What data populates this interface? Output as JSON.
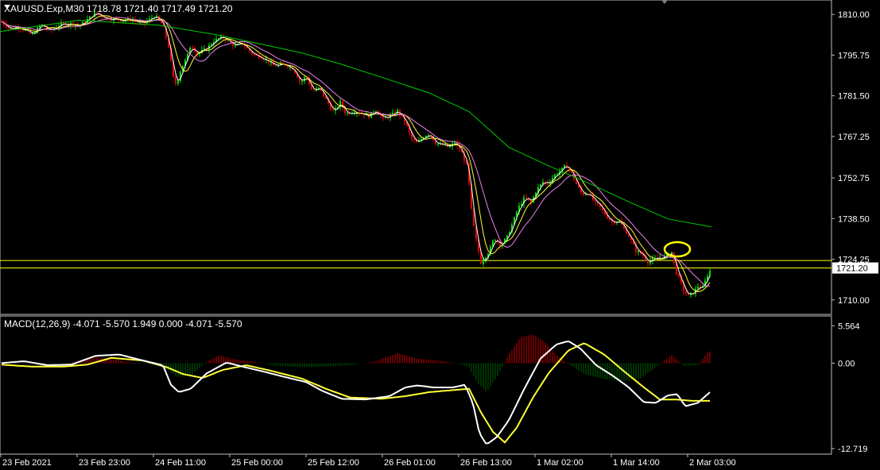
{
  "header": {
    "symbol_line": "XAUUSD.Exp,M30  1718.78 1721.40 1717.49 1721.20",
    "macd_line": "MACD(12,26,9) -4.071 -5.570 1.949 0.000 -4.071 -5.570"
  },
  "colors": {
    "background": "#000000",
    "bull": "#00e000",
    "bear": "#e00000",
    "ma_fast": "#ffffff",
    "ma_yellow": "#ffff33",
    "ma_violet": "#ee82ee",
    "ma_green": "#00cc00",
    "price_line": "#ffff00",
    "macd_main": "#ffffff",
    "macd_signal": "#ffff33",
    "hist_pos": "#cc0000",
    "hist_neg": "#006400",
    "marker": "#ffff00"
  },
  "chart_data": [
    {
      "type": "candlestick",
      "symbol": "XAUUSD.Exp",
      "timeframe": "M30",
      "ohlc_current": {
        "open": 1718.78,
        "high": 1721.4,
        "low": 1717.49,
        "close": 1721.2
      },
      "y_ticks": [
        1810.0,
        1795.75,
        1781.5,
        1767.25,
        1752.75,
        1738.5,
        1724.25,
        1710.0
      ],
      "ylim": [
        1705.5,
        1814.5
      ],
      "current_price_label": "1721.20",
      "horizontal_lines": [
        1723.8,
        1721.2
      ],
      "x_ticks": [
        "23 Feb 2021",
        "23 Feb 23:00",
        "24 Feb 11:00",
        "25 Feb 00:00",
        "25 Feb 12:00",
        "26 Feb 01:00",
        "26 Feb 13:00",
        "1 Mar 02:00",
        "1 Mar 14:00",
        "2 Mar 03:00"
      ],
      "close_path": [
        [
          0,
          1808.0
        ],
        [
          12,
          1805.0
        ],
        [
          25,
          1805.6
        ],
        [
          40,
          1802.8
        ],
        [
          52,
          1806.5
        ],
        [
          63,
          1804.2
        ],
        [
          75,
          1806.4
        ],
        [
          88,
          1806.8
        ],
        [
          100,
          1806.0
        ],
        [
          110,
          1808.2
        ],
        [
          120,
          1810.6
        ],
        [
          130,
          1809.1
        ],
        [
          142,
          1808.3
        ],
        [
          155,
          1808.1
        ],
        [
          167,
          1808.0
        ],
        [
          180,
          1806.6
        ],
        [
          195,
          1809.6
        ],
        [
          205,
          1806.2
        ],
        [
          212,
          1798.8
        ],
        [
          218,
          1787.8
        ],
        [
          222,
          1785.2
        ],
        [
          228,
          1791.2
        ],
        [
          235,
          1794.8
        ],
        [
          240,
          1799.6
        ],
        [
          248,
          1796.2
        ],
        [
          260,
          1798.1
        ],
        [
          270,
          1801.0
        ],
        [
          282,
          1802.1
        ],
        [
          295,
          1798.9
        ],
        [
          305,
          1799.8
        ],
        [
          318,
          1796.0
        ],
        [
          330,
          1795.0
        ],
        [
          345,
          1792.0
        ],
        [
          360,
          1792.5
        ],
        [
          370,
          1790.6
        ],
        [
          378,
          1786.0
        ],
        [
          385,
          1788.5
        ],
        [
          393,
          1783.0
        ],
        [
          402,
          1784.2
        ],
        [
          410,
          1780.1
        ],
        [
          420,
          1775.6
        ],
        [
          428,
          1779.2
        ],
        [
          435,
          1775.2
        ],
        [
          445,
          1776.1
        ],
        [
          455,
          1775.4
        ],
        [
          465,
          1774.2
        ],
        [
          472,
          1776.8
        ],
        [
          482,
          1773.4
        ],
        [
          492,
          1774.6
        ],
        [
          500,
          1776.2
        ],
        [
          510,
          1772.1
        ],
        [
          518,
          1766.4
        ],
        [
          525,
          1764.8
        ],
        [
          532,
          1767.0
        ],
        [
          540,
          1768.4
        ],
        [
          548,
          1765.0
        ],
        [
          556,
          1764.3
        ],
        [
          565,
          1763.4
        ],
        [
          572,
          1765.2
        ],
        [
          580,
          1762.1
        ],
        [
          588,
          1756.4
        ],
        [
          594,
          1738.5
        ],
        [
          600,
          1729.4
        ],
        [
          605,
          1723.1
        ],
        [
          610,
          1725.0
        ],
        [
          616,
          1727.4
        ],
        [
          622,
          1731.9
        ],
        [
          630,
          1729.1
        ],
        [
          638,
          1732.1
        ],
        [
          645,
          1737.0
        ],
        [
          652,
          1742.3
        ],
        [
          660,
          1745.9
        ],
        [
          668,
          1744.1
        ],
        [
          675,
          1748.6
        ],
        [
          683,
          1751.3
        ],
        [
          690,
          1751.0
        ],
        [
          698,
          1753.8
        ],
        [
          705,
          1755.2
        ],
        [
          712,
          1757.3
        ],
        [
          718,
          1755.1
        ],
        [
          725,
          1750.6
        ],
        [
          732,
          1747.0
        ],
        [
          740,
          1747.5
        ],
        [
          748,
          1744.1
        ],
        [
          755,
          1742.5
        ],
        [
          762,
          1739.6
        ],
        [
          770,
          1737.3
        ],
        [
          778,
          1737.8
        ],
        [
          786,
          1734.6
        ],
        [
          792,
          1732.0
        ],
        [
          800,
          1727.2
        ],
        [
          808,
          1725.9
        ],
        [
          815,
          1723.4
        ],
        [
          822,
          1724.1
        ],
        [
          830,
          1724.8
        ],
        [
          838,
          1725.2
        ],
        [
          845,
          1726.8
        ],
        [
          850,
          1720.0
        ],
        [
          855,
          1717.2
        ],
        [
          860,
          1713.4
        ],
        [
          866,
          1711.3
        ],
        [
          872,
          1712.5
        ],
        [
          878,
          1714.8
        ],
        [
          884,
          1714.2
        ],
        [
          890,
          1718.8
        ],
        [
          895,
          1721.2
        ]
      ],
      "ma_green_path": [
        [
          0,
          1804.0
        ],
        [
          100,
          1808.0
        ],
        [
          200,
          1806.2
        ],
        [
          270,
          1803.0
        ],
        [
          330,
          1799.5
        ],
        [
          380,
          1796.5
        ],
        [
          430,
          1792.5
        ],
        [
          480,
          1788.0
        ],
        [
          540,
          1782.5
        ],
        [
          590,
          1776.0
        ],
        [
          640,
          1763.5
        ],
        [
          690,
          1757.0
        ],
        [
          740,
          1751.0
        ],
        [
          790,
          1744.5
        ],
        [
          840,
          1738.4
        ],
        [
          895,
          1735.6
        ]
      ]
    },
    {
      "type": "macd",
      "title": "MACD(12,26,9)",
      "params": [
        12,
        26,
        9
      ],
      "values": {
        "main": -4.071,
        "signal": -5.57
      },
      "y_ticks": [
        5.564,
        0.0,
        -12.719
      ],
      "ylim": [
        -13.3,
        6.8
      ],
      "main_path": [
        [
          0,
          0.0
        ],
        [
          30,
          0.3
        ],
        [
          60,
          -0.3
        ],
        [
          90,
          -0.2
        ],
        [
          120,
          1.1
        ],
        [
          150,
          1.3
        ],
        [
          180,
          0.4
        ],
        [
          205,
          -0.3
        ],
        [
          215,
          -3.2
        ],
        [
          225,
          -4.3
        ],
        [
          240,
          -3.8
        ],
        [
          260,
          -1.5
        ],
        [
          285,
          0.1
        ],
        [
          305,
          -0.5
        ],
        [
          330,
          -1.2
        ],
        [
          360,
          -2.1
        ],
        [
          385,
          -2.8
        ],
        [
          405,
          -4.1
        ],
        [
          430,
          -5.3
        ],
        [
          460,
          -5.4
        ],
        [
          490,
          -4.9
        ],
        [
          510,
          -3.6
        ],
        [
          525,
          -3.3
        ],
        [
          545,
          -3.6
        ],
        [
          570,
          -3.6
        ],
        [
          585,
          -3.2
        ],
        [
          595,
          -6.0
        ],
        [
          603,
          -10.4
        ],
        [
          612,
          -12.1
        ],
        [
          625,
          -11.0
        ],
        [
          640,
          -8.5
        ],
        [
          660,
          -3.7
        ],
        [
          680,
          0.7
        ],
        [
          700,
          2.8
        ],
        [
          715,
          3.3
        ],
        [
          730,
          2.2
        ],
        [
          750,
          -0.3
        ],
        [
          770,
          -1.8
        ],
        [
          790,
          -3.5
        ],
        [
          810,
          -5.8
        ],
        [
          825,
          -5.9
        ],
        [
          840,
          -4.8
        ],
        [
          852,
          -4.6
        ],
        [
          862,
          -6.4
        ],
        [
          878,
          -5.9
        ],
        [
          895,
          -4.1
        ]
      ],
      "signal_path": [
        [
          0,
          -0.2
        ],
        [
          40,
          -0.5
        ],
        [
          80,
          -0.5
        ],
        [
          110,
          -0.2
        ],
        [
          140,
          0.8
        ],
        [
          180,
          0.4
        ],
        [
          210,
          -0.6
        ],
        [
          230,
          -1.6
        ],
        [
          255,
          -2.2
        ],
        [
          280,
          -1.0
        ],
        [
          310,
          -0.3
        ],
        [
          340,
          -1.1
        ],
        [
          380,
          -2.3
        ],
        [
          410,
          -3.8
        ],
        [
          440,
          -5.1
        ],
        [
          480,
          -5.3
        ],
        [
          510,
          -4.9
        ],
        [
          540,
          -4.3
        ],
        [
          570,
          -4.0
        ],
        [
          590,
          -3.8
        ],
        [
          605,
          -7.3
        ],
        [
          620,
          -10.2
        ],
        [
          635,
          -11.8
        ],
        [
          650,
          -9.6
        ],
        [
          670,
          -5.2
        ],
        [
          690,
          -1.5
        ],
        [
          715,
          1.9
        ],
        [
          735,
          3.0
        ],
        [
          760,
          1.3
        ],
        [
          785,
          -1.2
        ],
        [
          810,
          -3.6
        ],
        [
          830,
          -5.4
        ],
        [
          850,
          -5.4
        ],
        [
          870,
          -5.6
        ],
        [
          895,
          -5.6
        ]
      ],
      "histogram_path": [
        [
          0,
          0.1
        ],
        [
          80,
          -0.2
        ],
        [
          115,
          0.9
        ],
        [
          135,
          0.8
        ],
        [
          160,
          0.2
        ],
        [
          200,
          -0.3
        ],
        [
          225,
          -2.1
        ],
        [
          240,
          -1.8
        ],
        [
          260,
          0.2
        ],
        [
          275,
          1.2
        ],
        [
          295,
          0.6
        ],
        [
          320,
          0.2
        ],
        [
          350,
          -0.4
        ],
        [
          380,
          -0.6
        ],
        [
          410,
          -0.5
        ],
        [
          440,
          -0.3
        ],
        [
          470,
          0.2
        ],
        [
          500,
          1.5
        ],
        [
          525,
          0.7
        ],
        [
          550,
          0.4
        ],
        [
          575,
          0.0
        ],
        [
          590,
          -0.6
        ],
        [
          600,
          -2.8
        ],
        [
          612,
          -4.3
        ],
        [
          625,
          -2.1
        ],
        [
          640,
          1.3
        ],
        [
          655,
          3.9
        ],
        [
          670,
          4.3
        ],
        [
          685,
          3.2
        ],
        [
          700,
          1.2
        ],
        [
          715,
          -0.1
        ],
        [
          735,
          -1.6
        ],
        [
          760,
          -2.4
        ],
        [
          785,
          -2.6
        ],
        [
          805,
          -2.3
        ],
        [
          825,
          -0.6
        ],
        [
          845,
          1.2
        ],
        [
          860,
          -0.4
        ],
        [
          878,
          -0.3
        ],
        [
          890,
          1.6
        ],
        [
          895,
          1.9
        ]
      ]
    }
  ]
}
